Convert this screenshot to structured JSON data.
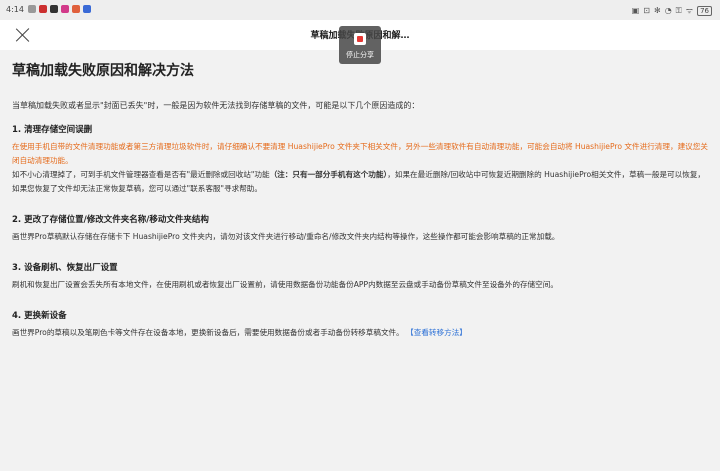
{
  "status_bar": {
    "time": "4:14",
    "right_indicators": [
      "▣",
      "⊡",
      "✻",
      "◔",
      "⚿",
      "ᯤ"
    ],
    "battery": "76",
    "app_icon_colors": [
      "#999999",
      "#cc2f2f",
      "#333333",
      "#d23a8a",
      "#e0603c",
      "#3a6ad6"
    ]
  },
  "header": {
    "title": "草稿加载失败原因和解…"
  },
  "stop_share": {
    "label": "停止分享"
  },
  "article": {
    "heading": "草稿加载失败原因和解决方法",
    "intro": "当草稿加载失败或者显示\"封面已丢失\"时，一般是因为软件无法找到存储草稿的文件，可能是以下几个原因造成的：",
    "sections": [
      {
        "title": "1. 清理存储空间误删",
        "orange_text": "在使用手机自带的文件清理功能或者第三方清理垃圾软件时，请仔细确认不要清理 HuashijiePro 文件夹下相关文件，另外一些清理软件有自动清理功能，可能会自动将 HuashijiePro 文件进行清理，建议您关闭自动清理功能。",
        "body_before_bold": "如不小心清理掉了，可到手机文件管理器查看是否有\"最近删除或回收站\"功能",
        "body_bold": "（注：只有一部分手机有这个功能）",
        "body_after_bold": "，如果在最近删除/回收站中可恢复近期删除的 HuashijiePro相关文件，草稿一般是可以恢复，如果您恢复了文件却无法正常恢复草稿，您可以通过\"联系客服\"寻求帮助。"
      },
      {
        "title": "2. 更改了存储位置/修改文件夹名称/移动文件夹结构",
        "body": "画世界Pro草稿默认存储在存储卡下 HuashijiePro 文件夹内，请勿对该文件夹进行移动/重命名/修改文件夹内结构等操作，这些操作都可能会影响草稿的正常加载。"
      },
      {
        "title": "3. 设备刷机、恢复出厂设置",
        "body": "刷机和恢复出厂设置会丢失所有本地文件，在使用刷机或者恢复出厂设置前，请使用数据备份功能备份APP内数据至云盘或手动备份草稿文件至设备外的存储空间。"
      },
      {
        "title": "4. 更换新设备",
        "body": "画世界Pro的草稿以及笔刷色卡等文件存在设备本地，更换新设备后，需要使用数据备份或者手动备份转移草稿文件。",
        "link_label": "【查看转移方法】"
      }
    ]
  }
}
